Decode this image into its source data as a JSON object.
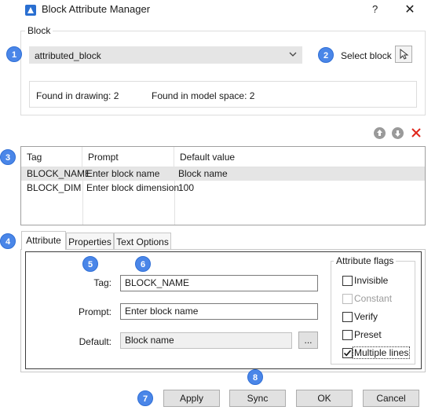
{
  "window": {
    "title": "Block Attribute Manager",
    "help": "?",
    "close": "✕"
  },
  "block_group": {
    "label": "Block",
    "selected_block": "attributed_block",
    "select_label": "Select block",
    "found_in_drawing": "Found in drawing: 2",
    "found_in_model_space": "Found in model space: 2"
  },
  "table": {
    "columns": [
      "Tag",
      "Prompt",
      "Default value"
    ],
    "rows": [
      {
        "tag": "BLOCK_NAME",
        "prompt": "Enter block name",
        "default": "Block name"
      },
      {
        "tag": "BLOCK_DIM",
        "prompt": "Enter block dimension",
        "default": "100"
      }
    ]
  },
  "list_tools": {
    "up": "↑",
    "down": "↓",
    "remove": "✕",
    "remove_color": "#e0261b"
  },
  "tabs": [
    "Attribute",
    "Properties",
    "Text Options"
  ],
  "attribute": {
    "tag_label": "Tag:",
    "tag_value": "BLOCK_NAME",
    "prompt_label": "Prompt:",
    "prompt_value": "Enter block name",
    "default_label": "Default:",
    "default_value": "Block name",
    "browse_label": "..."
  },
  "flags": {
    "label": "Attribute flags",
    "items": [
      {
        "label": "Invisible",
        "checked": false,
        "enabled": true
      },
      {
        "label": "Constant",
        "checked": false,
        "enabled": false
      },
      {
        "label": "Verify",
        "checked": false,
        "enabled": true
      },
      {
        "label": "Preset",
        "checked": false,
        "enabled": true
      },
      {
        "label": "Multiple lines",
        "checked": true,
        "enabled": true
      }
    ]
  },
  "buttons": {
    "apply": "Apply",
    "sync": "Sync",
    "ok": "OK",
    "cancel": "Cancel"
  },
  "callouts": [
    "1",
    "2",
    "3",
    "4",
    "5",
    "6",
    "7",
    "8"
  ],
  "colors": {
    "callout": "#4a86e8",
    "selection": "#e5e5e5"
  }
}
